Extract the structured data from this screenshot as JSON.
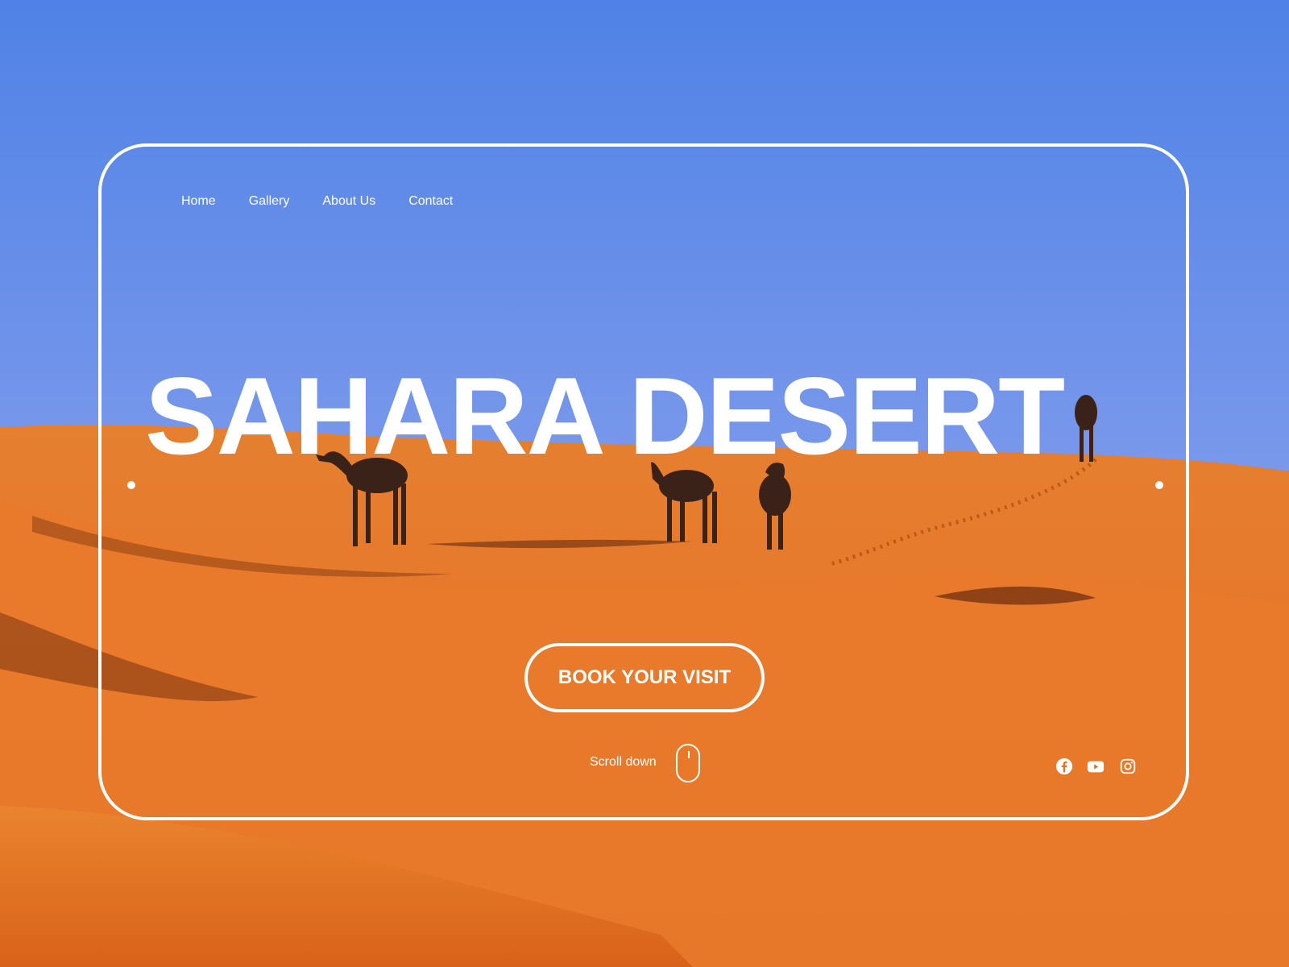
{
  "nav": {
    "items": [
      {
        "label": "Home"
      },
      {
        "label": "Gallery"
      },
      {
        "label": "About Us"
      },
      {
        "label": "Contact"
      }
    ]
  },
  "hero": {
    "title": "SAHARA DESERT",
    "cta_label": "BOOK YOUR VISIT",
    "scroll_label": "Scroll down"
  },
  "social": {
    "icons": [
      "facebook-icon",
      "youtube-icon",
      "instagram-icon"
    ]
  },
  "colors": {
    "sky_top": "#4f82e6",
    "sky_bottom": "#8ea6ee",
    "sand_light": "#e9782c",
    "sand_dark": "#c95612",
    "text": "#ffffff"
  }
}
